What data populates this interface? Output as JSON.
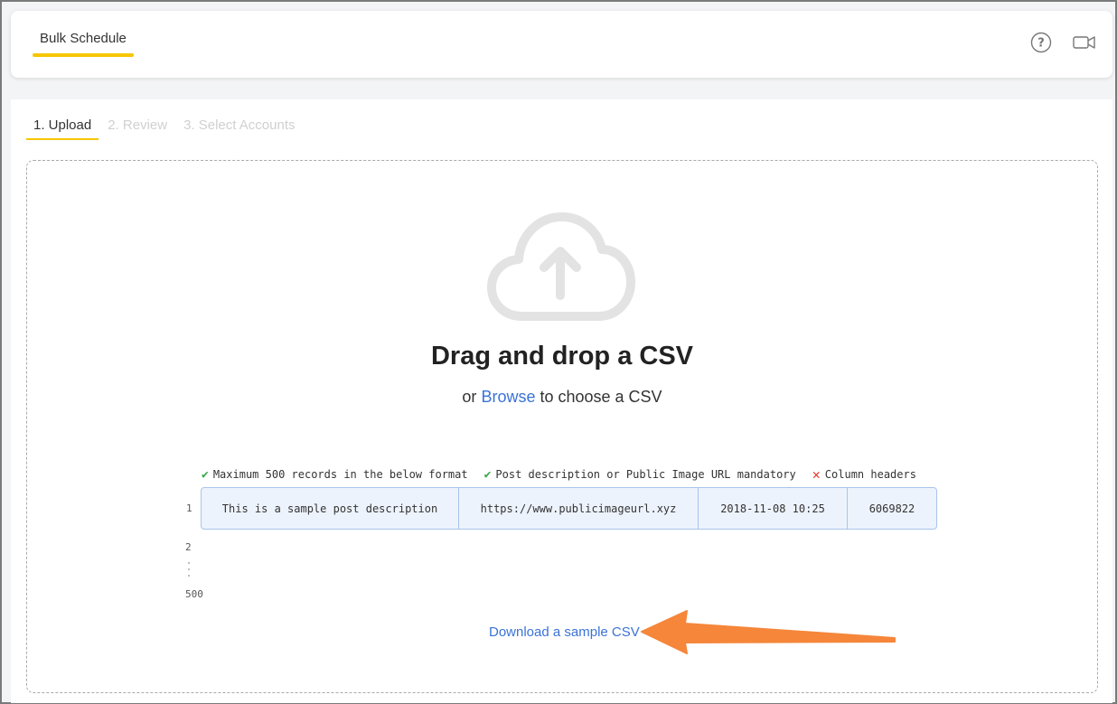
{
  "header": {
    "title": "Bulk Schedule",
    "icons": [
      "help-circle-icon",
      "video-camera-icon"
    ]
  },
  "steps": [
    {
      "label": "1. Upload",
      "active": true
    },
    {
      "label": "2. Review",
      "active": false
    },
    {
      "label": "3. Select Accounts",
      "active": false
    }
  ],
  "dropzone": {
    "icon": "cloud-upload-icon",
    "title": "Drag and drop a CSV",
    "sub_prefix": "or",
    "browse_label": "Browse",
    "sub_suffix": "to choose a CSV"
  },
  "rules": [
    {
      "status": "ok",
      "icon": "check-icon",
      "text": "Maximum 500 records in the below format"
    },
    {
      "status": "ok",
      "icon": "check-icon",
      "text": "Post description or Public Image URL mandatory"
    },
    {
      "status": "bad",
      "icon": "x-icon",
      "text": "Column headers"
    }
  ],
  "sample": {
    "row_numbers": [
      "1",
      "2",
      "500"
    ],
    "cells": [
      "This is a sample post description",
      "https://www.publicimageurl.xyz",
      "2018-11-08 10:25",
      "6069822"
    ]
  },
  "download_label": "Download a sample CSV",
  "colors": {
    "accent": "#f7c600",
    "link": "#3b73d6",
    "ok": "#3aa64a",
    "bad": "#e03a2c",
    "annotation_arrow": "#f5863a"
  }
}
